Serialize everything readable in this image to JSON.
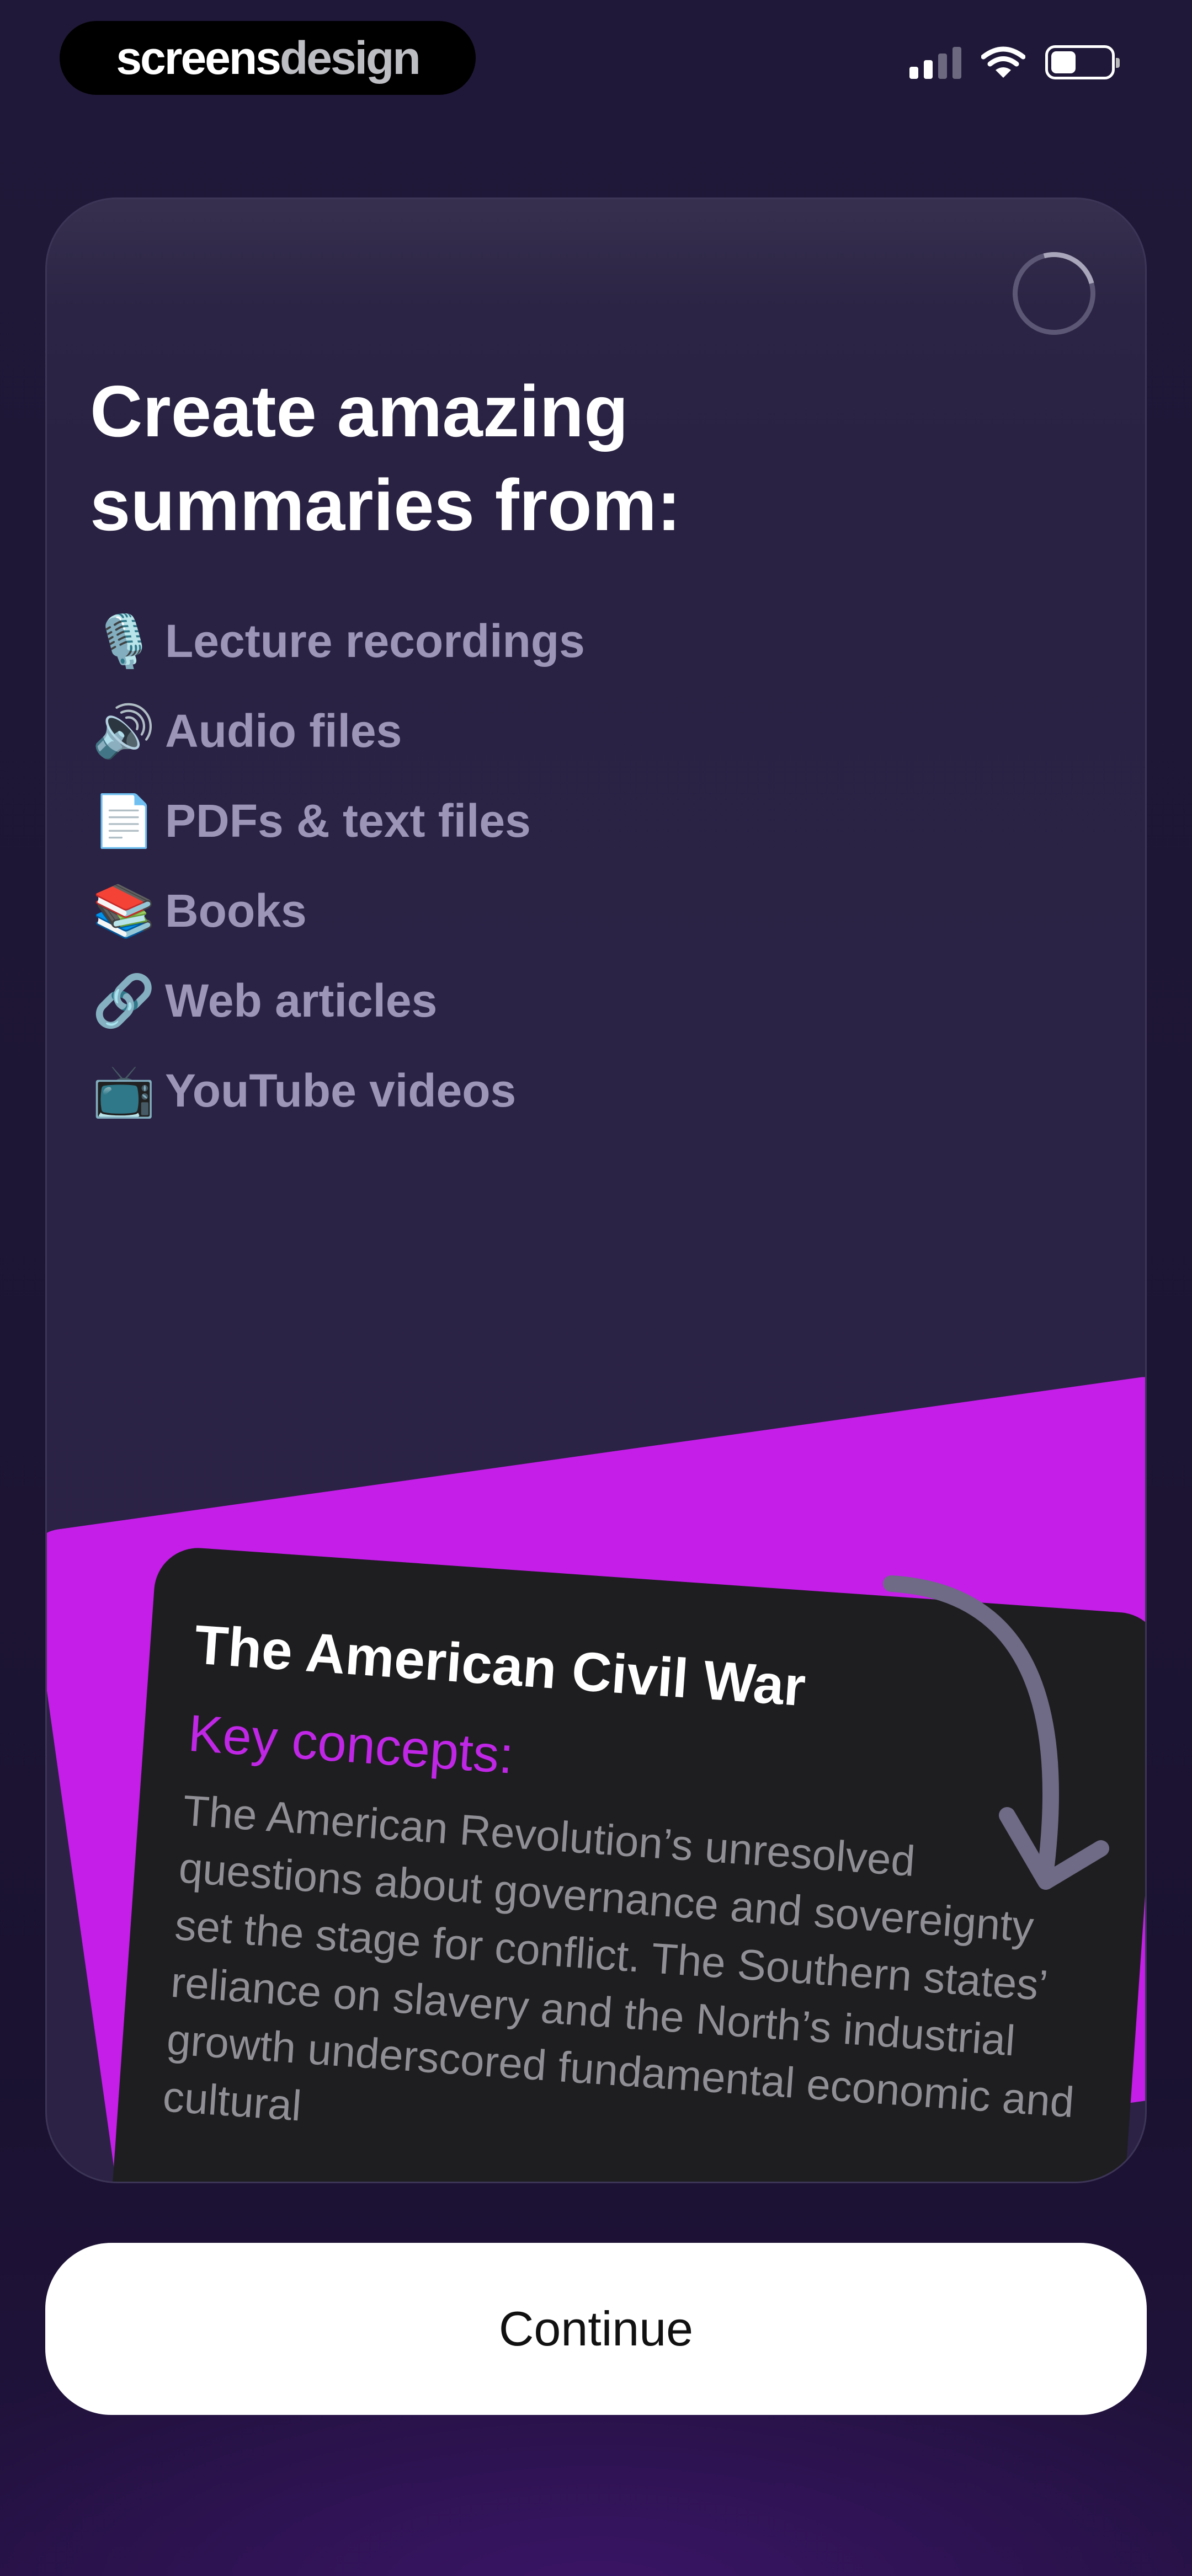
{
  "status_bar": {
    "badge_part1": "screens",
    "badge_part2": "design"
  },
  "card": {
    "headline": "Create amazing summaries from:",
    "features": [
      {
        "icon": "microphone-icon",
        "emoji": "🎙️",
        "label": "Lecture recordings"
      },
      {
        "icon": "speaker-icon",
        "emoji": "🔊",
        "label": "Audio files"
      },
      {
        "icon": "document-icon",
        "emoji": "📄",
        "label": "PDFs & text files"
      },
      {
        "icon": "books-icon",
        "emoji": "📚",
        "label": "Books"
      },
      {
        "icon": "link-icon",
        "emoji": "🔗",
        "label": "Web articles"
      },
      {
        "icon": "tv-icon",
        "emoji": "📺",
        "label": "YouTube videos"
      }
    ]
  },
  "summary_preview": {
    "title": "The American Civil War",
    "subtitle": "Key concepts:",
    "body": "The American Revolution’s unresolved questions about governance and sovereignty set the stage for conflict. The Southern states’ reliance on slavery and the North’s industrial growth underscored fundamental economic and cultural"
  },
  "continue_button": {
    "label": "Continue"
  },
  "colors": {
    "background": "#1d1634",
    "accent_purple": "#c41ee8",
    "feature_text": "#9d95b8",
    "summary_card": "#1e1e20"
  }
}
